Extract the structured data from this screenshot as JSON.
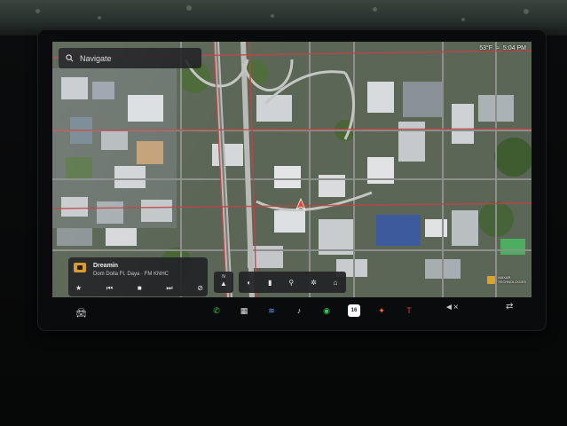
{
  "search": {
    "label": "Navigate"
  },
  "status": {
    "temperature": "53°F",
    "time": "5:04 PM"
  },
  "media": {
    "title": "Dreamin",
    "artist": "Dom Dolla Ft. Daya · FM KNHC"
  },
  "compass": {
    "heading": "N"
  },
  "map_tools": [
    "settings",
    "charging",
    "navigation-pin",
    "location",
    "camera"
  ],
  "calendar_day": "16",
  "watermark": {
    "line1": "MAXAR",
    "line2": "TECHNOLOGIES"
  },
  "dock": [
    {
      "name": "phone",
      "color": "#2ec95a",
      "glyph": "✆"
    },
    {
      "name": "apps",
      "color": "#e0e0e0",
      "glyph": "▦"
    },
    {
      "name": "siriusxm",
      "color": "#4aa3ff",
      "glyph": "≋"
    },
    {
      "name": "media",
      "color": "#e0e0e0",
      "glyph": "♪"
    },
    {
      "name": "spotify",
      "color": "#2ec95a",
      "glyph": "◉"
    },
    {
      "name": "calendar",
      "color": "#ffffff",
      "glyph": ""
    },
    {
      "name": "toybox",
      "color": "#ff6a3d",
      "glyph": "✦"
    },
    {
      "name": "tesla",
      "color": "#e8423a",
      "glyph": "T"
    }
  ],
  "colors": {
    "map_bg": "#4f5a4a",
    "route_red": "#c04444",
    "card_bg": "#222427",
    "accent_red": "#e8423a"
  }
}
